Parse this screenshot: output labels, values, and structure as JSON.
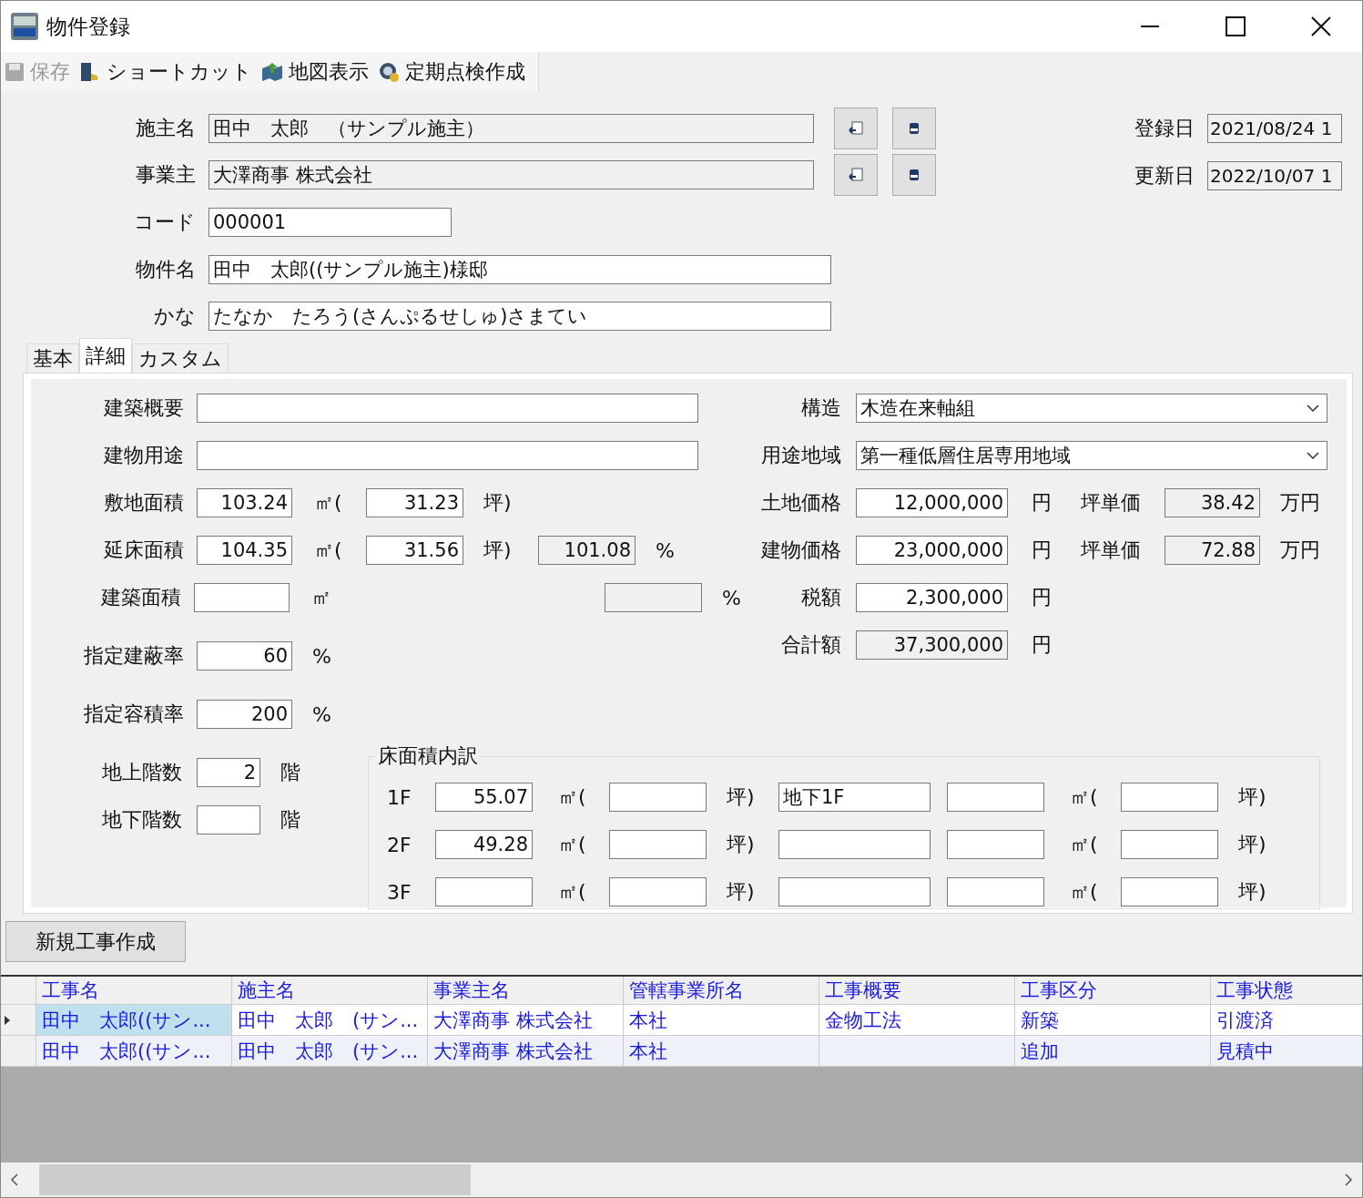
{
  "window": {
    "title": "物件登録"
  },
  "toolbar": [
    {
      "kind": "save",
      "label": "保存",
      "disabled": true
    },
    {
      "kind": "shortcut",
      "label": "ショートカット",
      "disabled": false
    },
    {
      "kind": "map",
      "label": "地図表示",
      "disabled": false
    },
    {
      "kind": "inspection",
      "label": "定期点検作成",
      "disabled": false
    }
  ],
  "header_fields": [
    {
      "kind": "lookup",
      "label": "施主名",
      "value": "田中　太郎　（サンプル施主）"
    },
    {
      "kind": "lookup",
      "label": "事業主",
      "value": "大澤商事 株式会社"
    },
    {
      "kind": "short",
      "label": "コード",
      "value": "000001"
    },
    {
      "kind": "long",
      "label": "物件名",
      "value": "田中　太郎((サンプル施主)様邸"
    },
    {
      "kind": "long",
      "label": "かな",
      "value": "たなか　たろう(さんぷるせしゅ)さまてい"
    }
  ],
  "dates": [
    {
      "label": "登録日",
      "value": "2021/08/24 1"
    },
    {
      "label": "更新日",
      "value": "2022/10/07 1"
    }
  ],
  "tabs": [
    {
      "label": "基本",
      "selected": false
    },
    {
      "label": "詳細",
      "selected": true
    },
    {
      "label": "カスタム",
      "selected": false
    }
  ],
  "detail_left": [
    {
      "kind": "text",
      "label": "建築概要"
    },
    {
      "kind": "text",
      "label": "建物用途"
    },
    {
      "kind": "area",
      "label": "敷地面積",
      "value": "103.24",
      "unit": "㎡(",
      "tsubo": "31.23",
      "tsubo_unit": "坪)"
    },
    {
      "kind": "area",
      "label": "延床面積",
      "value": "104.35",
      "unit": "㎡(",
      "tsubo": "31.56",
      "tsubo_unit": "坪)",
      "ratio": "101.08",
      "ratio_unit": "%"
    },
    {
      "kind": "area",
      "label": "建築面積",
      "unit": "㎡",
      "ratio_unit": "%"
    },
    {
      "kind": "rate",
      "label": "指定建蔽率",
      "value": "60",
      "unit": "%"
    },
    {
      "kind": "rate",
      "label": "指定容積率",
      "value": "200",
      "unit": "%"
    }
  ],
  "detail_right": [
    {
      "kind": "select",
      "label": "構造",
      "value": "木造在来軸組"
    },
    {
      "kind": "select",
      "label": "用途地域",
      "value": "第一種低層住居専用地域"
    },
    {
      "kind": "price",
      "label": "土地価格",
      "value": "12,000,000",
      "unit": "円",
      "readonly": false,
      "unit_price_label": "坪単価",
      "unit_price": "38.42",
      "unit_price_unit": "万円"
    },
    {
      "kind": "price",
      "label": "建物価格",
      "value": "23,000,000",
      "unit": "円",
      "readonly": false,
      "unit_price_label": "坪単価",
      "unit_price": "72.88",
      "unit_price_unit": "万円"
    },
    {
      "kind": "price",
      "label": "税額",
      "value": "2,300,000",
      "unit": "円",
      "readonly": false
    },
    {
      "kind": "price",
      "label": "合計額",
      "value": "37,300,000",
      "unit": "円",
      "readonly": true
    }
  ],
  "floors": [
    {
      "label": "地上階数",
      "value": "2",
      "unit": "階"
    },
    {
      "label": "地下階数",
      "unit": "階"
    }
  ],
  "floor_breakdown": {
    "title": "床面積内訳",
    "rows": [
      {
        "label": "1F",
        "area": "55.07",
        "units": [
          "㎡(",
          "坪)",
          "㎡(",
          "坪)"
        ],
        "name": "地下1F"
      },
      {
        "label": "2F",
        "area": "49.28",
        "units": [
          "㎡(",
          "坪)",
          "㎡(",
          "坪)"
        ]
      },
      {
        "label": "3F",
        "units": [
          "㎡(",
          "坪)",
          "㎡(",
          "坪)"
        ]
      }
    ]
  },
  "new_work_button": "新規工事作成",
  "table": {
    "columns": [
      "工事名",
      "施主名",
      "事業主名",
      "管轄事業所名",
      "工事概要",
      "工事区分",
      "工事状態"
    ],
    "rows": [
      {
        "selected": true,
        "cells": [
          "田中　太郎((サン...",
          "田中　太郎　(サン...",
          "大澤商事 株式会社",
          "本社",
          "金物工法",
          "新築",
          "引渡済"
        ]
      },
      {
        "selected": false,
        "cells": [
          "田中　太郎((サン...",
          "田中　太郎　(サン...",
          "大澤商事 株式会社",
          "本社",
          null,
          "追加",
          "見積中"
        ]
      }
    ]
  }
}
